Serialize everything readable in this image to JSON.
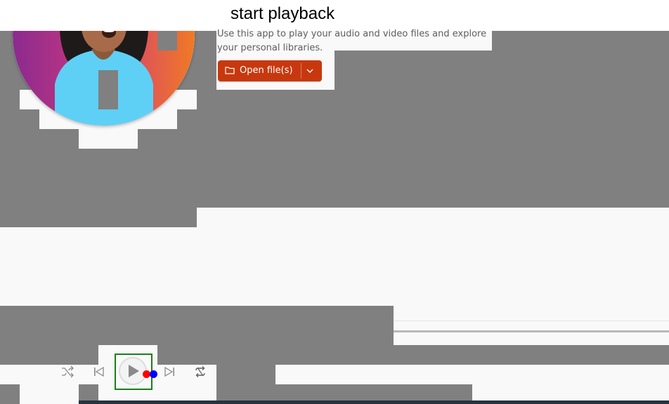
{
  "instruction": "start playback",
  "welcome": {
    "description": "Use this app to play your audio and video files and explore your personal libraries.",
    "open_button_label": "Open file(s)",
    "open_button_color": "#c8380e"
  },
  "player": {
    "controls": [
      "shuffle-icon",
      "previous-icon",
      "play-icon",
      "next-icon",
      "repeat-icon"
    ],
    "highlight_color": "#1a7f1a",
    "markers": [
      "#ff0000",
      "#0000ff"
    ]
  }
}
